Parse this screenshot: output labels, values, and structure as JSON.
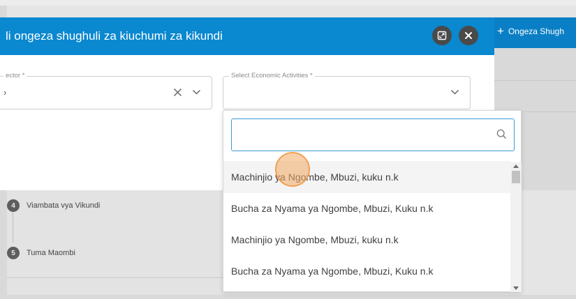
{
  "modal": {
    "title": "li ongeza shughuli za kiuchumi za kikundi",
    "expand_icon": "expand-icon",
    "close_icon": "close-icon"
  },
  "fields": {
    "sector": {
      "label": "ector *",
      "value": "›"
    },
    "economic": {
      "label": "Select Economic Activities *",
      "value": ""
    }
  },
  "background": {
    "add_button": "Ongeza Shugh",
    "steps": [
      {
        "num": "4",
        "label": "Viambata vya Vikundi"
      },
      {
        "num": "5",
        "label": "Tuma Maombi"
      }
    ]
  },
  "dropdown": {
    "search_placeholder": "",
    "options": [
      "Machinjio ya Ngombe, Mbuzi, kuku n.k",
      "Bucha za Nyama ya Ngombe, Mbuzi, Kuku n.k",
      "Machinjio ya Ngombe, Mbuzi, kuku n.k",
      "Bucha za Nyama ya Ngombe, Mbuzi, Kuku n.k"
    ]
  },
  "colors": {
    "header": "#0a88d0",
    "accent": "#3b9ad6",
    "click_marker": "#f0a055"
  }
}
